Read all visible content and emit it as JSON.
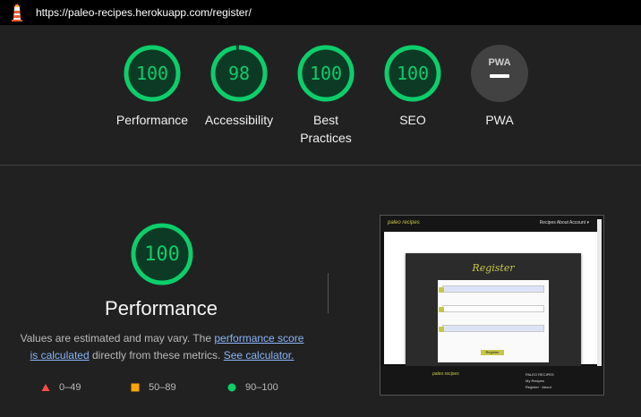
{
  "browser": {
    "url": "https://paleo-recipes.herokuapp.com/register/"
  },
  "colors": {
    "pass": "#0cce6b",
    "average": "#ffa400",
    "fail": "#ff4e42",
    "pwa_gray": "#9e9e9e",
    "background": "#212121"
  },
  "categories": [
    {
      "label": "Performance",
      "score": 100
    },
    {
      "label": "Accessibility",
      "score": 98
    },
    {
      "label": "Best Practices",
      "score": 100
    },
    {
      "label": "SEO",
      "score": 100
    },
    {
      "label": "PWA",
      "badge": "PWA",
      "score": null
    }
  ],
  "performance": {
    "score": "100",
    "title": "Performance",
    "desc_prefix": "Values are estimated and may vary. The ",
    "link_score": "performance score is calculated",
    "desc_middle": " directly from these metrics. ",
    "link_calc": "See calculator."
  },
  "legend": [
    {
      "icon": "triangle-icon",
      "range": "0–49"
    },
    {
      "icon": "square-icon",
      "range": "50–89"
    },
    {
      "icon": "circle-icon",
      "range": "90–100"
    }
  ],
  "screenshot": {
    "brand": "paleo recipes",
    "nav_links": "Recipes  About  Account ▾",
    "heading": "Register",
    "button": "Register",
    "footer_brand": "paleo recipes",
    "footer_col_title": "PALEO RECIPES",
    "footer_links": [
      "My Recipes",
      "Register  ·  About"
    ]
  }
}
